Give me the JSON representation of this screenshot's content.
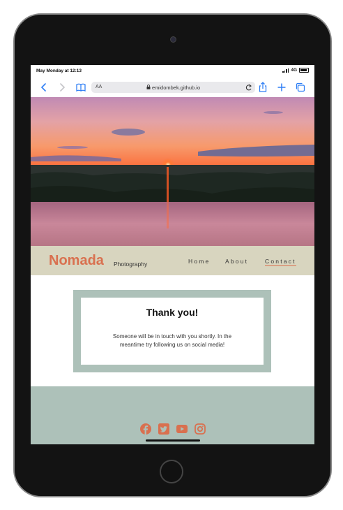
{
  "status": {
    "time": "May Monday at 12:13",
    "network": "4G"
  },
  "browser": {
    "reader_label": "AA",
    "url": "emidombek.github.io",
    "back_icon": "chevron-left-icon",
    "forward_icon": "chevron-right-icon",
    "bookmarks_icon": "book-icon",
    "reload_icon": "reload-icon",
    "share_icon": "share-icon",
    "new_tab_icon": "plus-icon",
    "tabs_icon": "tabs-icon"
  },
  "site": {
    "brand": "Nomada",
    "brand_sub": "Photography",
    "nav": [
      {
        "label": "Home"
      },
      {
        "label": "About"
      },
      {
        "label": "Contact"
      }
    ],
    "active_nav": "Contact"
  },
  "thank_you": {
    "title": "Thank you!",
    "message": "Someone will be in touch with you shortly. In the meantime try following us on social media!"
  },
  "social": [
    {
      "icon": "facebook-icon"
    },
    {
      "icon": "twitter-icon"
    },
    {
      "icon": "youtube-icon"
    },
    {
      "icon": "instagram-icon"
    }
  ],
  "colors": {
    "accent": "#d9704f",
    "nav_bg": "#d8d5bf",
    "sage": "#adc1b9",
    "link_blue": "#2f7ff5"
  }
}
